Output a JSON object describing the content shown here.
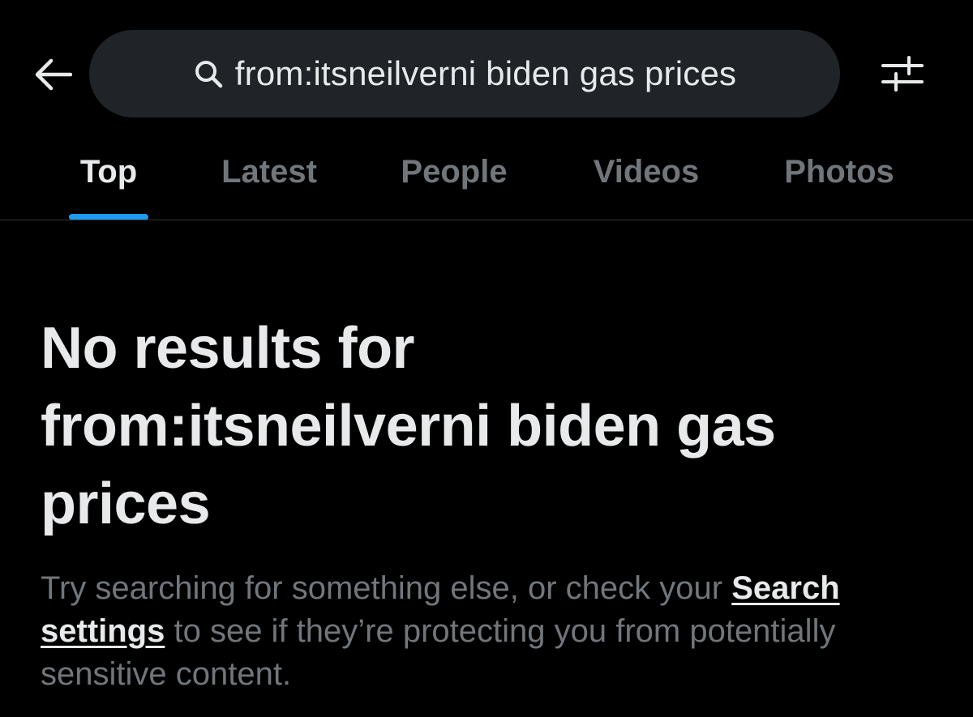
{
  "header": {
    "back_icon": "arrow-left-icon",
    "search": {
      "icon": "search-icon",
      "query": "from:itsneilverni biden gas prices"
    },
    "filter_icon": "sliders-icon"
  },
  "tabs": [
    {
      "label": "Top",
      "active": true
    },
    {
      "label": "Latest",
      "active": false
    },
    {
      "label": "People",
      "active": false
    },
    {
      "label": "Videos",
      "active": false
    },
    {
      "label": "Photos",
      "active": false
    }
  ],
  "empty_state": {
    "title_prefix": "No results for",
    "title_query": "from:itsneilverni biden gas prices",
    "body_before": "Try searching for something else, or check your ",
    "link_text": "Search settings",
    "body_after": " to see if they’re protecting you from potentially sensitive content."
  },
  "colors": {
    "background": "#000000",
    "search_pill": "#202327",
    "text_primary": "#e7e9ea",
    "text_secondary": "#71767b",
    "accent": "#1d9bf0",
    "divider": "#2f3336"
  }
}
